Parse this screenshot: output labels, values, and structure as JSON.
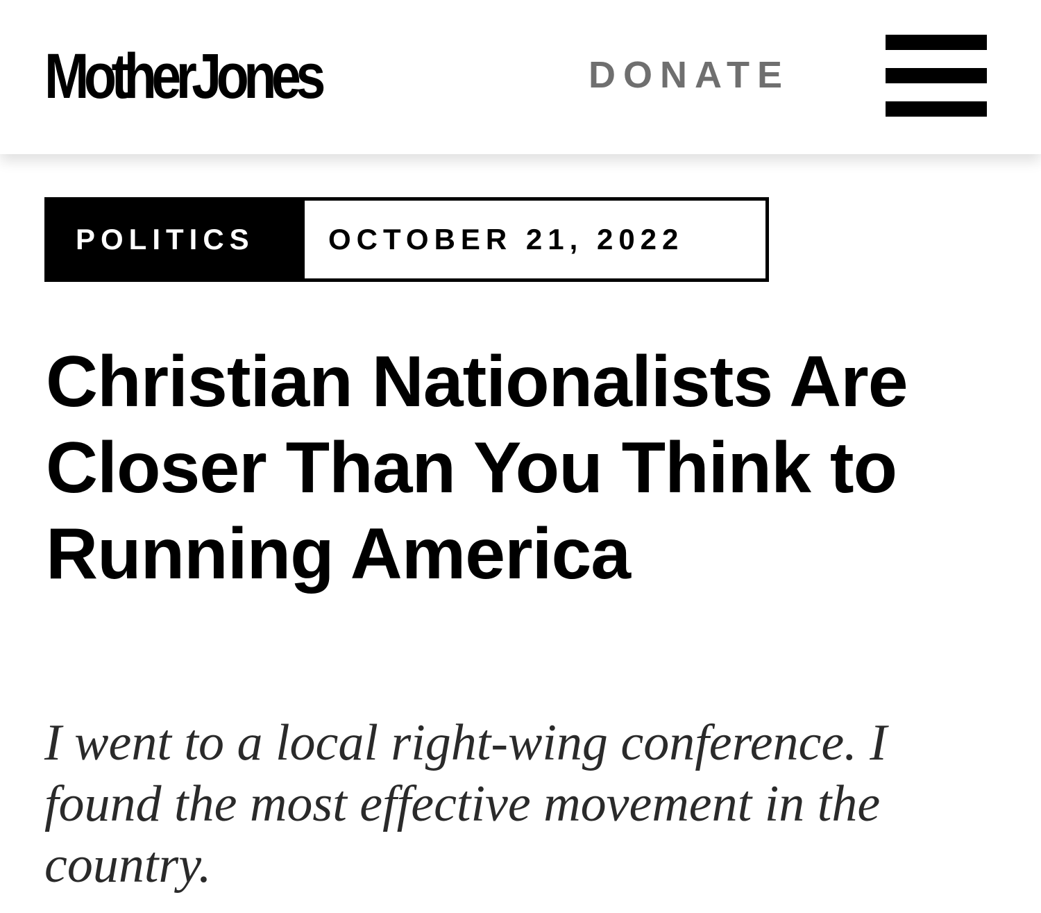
{
  "header": {
    "logo_text": "MotherJones",
    "donate_label": "DONATE",
    "menu_icon": "hamburger-menu-icon"
  },
  "article": {
    "section": "POLITICS",
    "date": "OCTOBER 21, 2022",
    "headline": "Christian Nationalists Are Closer Than You Think to Running America",
    "dek": "I went to a local right-wing conference. I found the most effective movement in the country."
  },
  "colors": {
    "background": "#ffffff",
    "text": "#000000",
    "donate": "#6f6f6f",
    "dek": "#2a2a2a"
  }
}
